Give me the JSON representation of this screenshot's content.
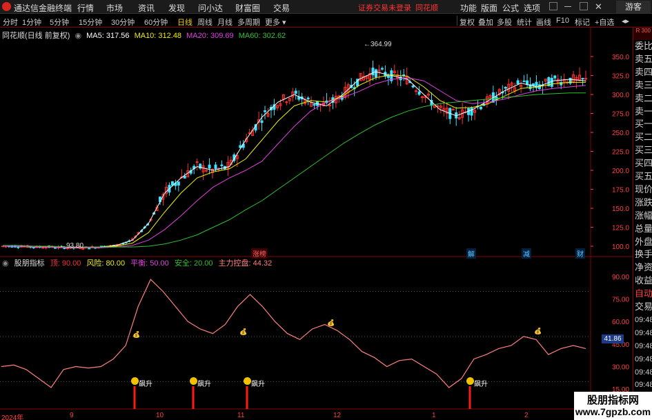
{
  "app": {
    "title": "通达信金融终端",
    "notice": "证券交易未登录",
    "notice_brand": "同花顺",
    "guest": "游客"
  },
  "menu": [
    "行情",
    "市场",
    "资讯",
    "发现",
    "问小达",
    "财富圈",
    "交易"
  ],
  "right_menu": [
    "功能",
    "版面",
    "公式",
    "选项"
  ],
  "periods": [
    "分时",
    "1分钟",
    "5分钟",
    "15分钟",
    "30分钟",
    "60分钟",
    "日线",
    "周线",
    "月线",
    "多周期",
    "更多"
  ],
  "active_period": "日线",
  "tools": [
    "复权",
    "叠加",
    "多股",
    "统计",
    "画线",
    "F10",
    "标记",
    "+自选"
  ],
  "ma_legend": {
    "stock_label": "同花顺(日线 前复权)",
    "ma5": "MA5: 317.56",
    "ma10": "MA10: 312.48",
    "ma20": "MA20: 309.69",
    "ma60": "MA60: 302.62",
    "colors": {
      "ma5": "#ffffff",
      "ma10": "#f0f000",
      "ma20": "#e040e0",
      "ma60": "#30c030"
    }
  },
  "price_axis": [
    "350.0",
    "325.0",
    "300.0",
    "275.0",
    "250.0",
    "225.0",
    "200.0",
    "175.0",
    "150.0",
    "125.0",
    "100.0"
  ],
  "price_annotations": {
    "high": "364.99",
    "low": "93.80"
  },
  "event_tags": [
    "涨榜",
    "解",
    "减",
    "财"
  ],
  "indicator_legend": {
    "name": "股朋指标",
    "top": "顶: 90.00",
    "risk": "风险: 80.00",
    "balance": "平衡: 50.00",
    "safe": "安全: 20.00",
    "main_control": "主力控盘: 44.32"
  },
  "indicator_axis": [
    "90.00",
    "75.00",
    "60.00",
    "45.00",
    "30.00",
    "15.00"
  ],
  "indicator_current": "41.86",
  "signal_label": "飙升",
  "x_axis": [
    "2024年",
    "9",
    "10",
    "11",
    "12",
    "1",
    "2"
  ],
  "right_panel": {
    "top_text": "R 300",
    "items": [
      "委比",
      "卖五",
      "卖四",
      "卖三",
      "卖二",
      "卖一",
      "买一",
      "买二",
      "买三",
      "买四",
      "买五",
      "现价",
      "涨跌",
      "涨幅",
      "总量",
      "外盘",
      "换手",
      "净资",
      "收益",
      "自动",
      "交易",
      "09:48",
      "09:48",
      "09:48",
      "09:48",
      "09:48",
      "09:48",
      "09:48",
      "09:48"
    ]
  },
  "watermark": {
    "line1": "股朋指标网",
    "line2": "www.7gpzb.com"
  },
  "chart_data": {
    "type": "line",
    "title": "",
    "ylim_price": [
      90,
      370
    ],
    "series": [
      {
        "name": "MA5",
        "values": [
          100,
          100,
          99,
          99,
          98,
          98,
          99,
          101,
          108,
          130,
          170,
          190,
          205,
          200,
          205,
          240,
          270,
          290,
          300,
          290,
          285,
          300,
          320,
          330,
          325,
          320,
          300,
          280,
          272,
          280,
          292,
          305,
          315,
          310,
          318,
          320,
          318
        ]
      },
      {
        "name": "MA10",
        "values": [
          100,
          100,
          99,
          99,
          98,
          98,
          99,
          100,
          104,
          118,
          145,
          170,
          190,
          198,
          202,
          215,
          240,
          265,
          285,
          292,
          290,
          298,
          312,
          322,
          326,
          324,
          310,
          292,
          282,
          283,
          288,
          298,
          308,
          310,
          314,
          316,
          316
        ]
      },
      {
        "name": "MA20",
        "values": [
          100,
          100,
          99,
          99,
          98,
          98,
          98,
          99,
          101,
          108,
          122,
          140,
          160,
          178,
          190,
          200,
          212,
          235,
          258,
          278,
          290,
          296,
          304,
          314,
          320,
          322,
          318,
          305,
          292,
          288,
          290,
          294,
          300,
          305,
          308,
          310,
          312
        ]
      },
      {
        "name": "MA60",
        "values": [
          101,
          101,
          100,
          100,
          99,
          99,
          99,
          99,
          99,
          100,
          103,
          108,
          115,
          125,
          135,
          148,
          160,
          175,
          190,
          205,
          220,
          235,
          248,
          260,
          270,
          278,
          284,
          288,
          290,
          292,
          294,
          296,
          298,
          300,
          301,
          302,
          302
        ]
      },
      {
        "name": "主力控盘",
        "values": [
          30,
          31,
          28,
          22,
          16,
          28,
          30,
          29,
          30,
          35,
          44,
          70,
          88,
          80,
          70,
          60,
          55,
          52,
          58,
          70,
          78,
          70,
          60,
          52,
          48,
          55,
          58,
          54,
          48,
          40,
          36,
          30,
          34,
          35,
          30,
          25,
          16,
          22,
          35,
          38,
          42,
          44,
          50,
          48,
          38,
          42,
          44,
          42
        ]
      }
    ]
  }
}
